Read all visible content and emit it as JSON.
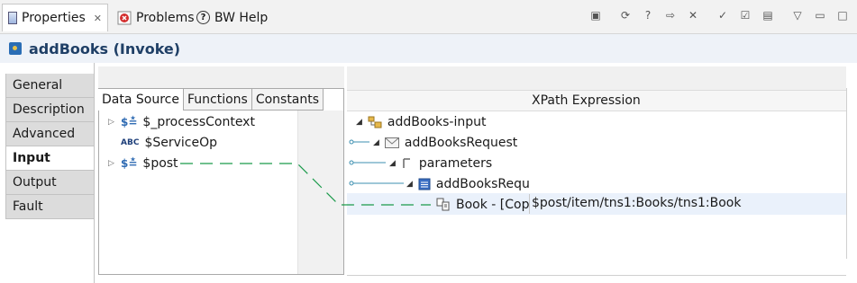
{
  "tabs": {
    "properties": "Properties",
    "problems": "Problems",
    "help": "BW Help"
  },
  "title": "addBooks (Invoke)",
  "side_tabs": [
    "General",
    "Description",
    "Advanced",
    "Input",
    "Output",
    "Fault"
  ],
  "active_side_tab": "Input",
  "data_source": {
    "tabs": [
      "Data Source",
      "Functions",
      "Constants"
    ],
    "items": [
      "$_processContext",
      "$ServiceOp",
      "$post"
    ]
  },
  "mapping": {
    "column_header": "XPath Expression",
    "nodes": {
      "root": "addBooks-input",
      "request": "addBooksRequest",
      "parameters": "parameters",
      "request_child": "addBooksRequ",
      "book": "Book - [Cop"
    },
    "xpath": "$post/item/tns1:Books/tns1:Book"
  },
  "colors": {
    "mapping_line": "#1a9a4a",
    "title": "#1f3f66"
  }
}
